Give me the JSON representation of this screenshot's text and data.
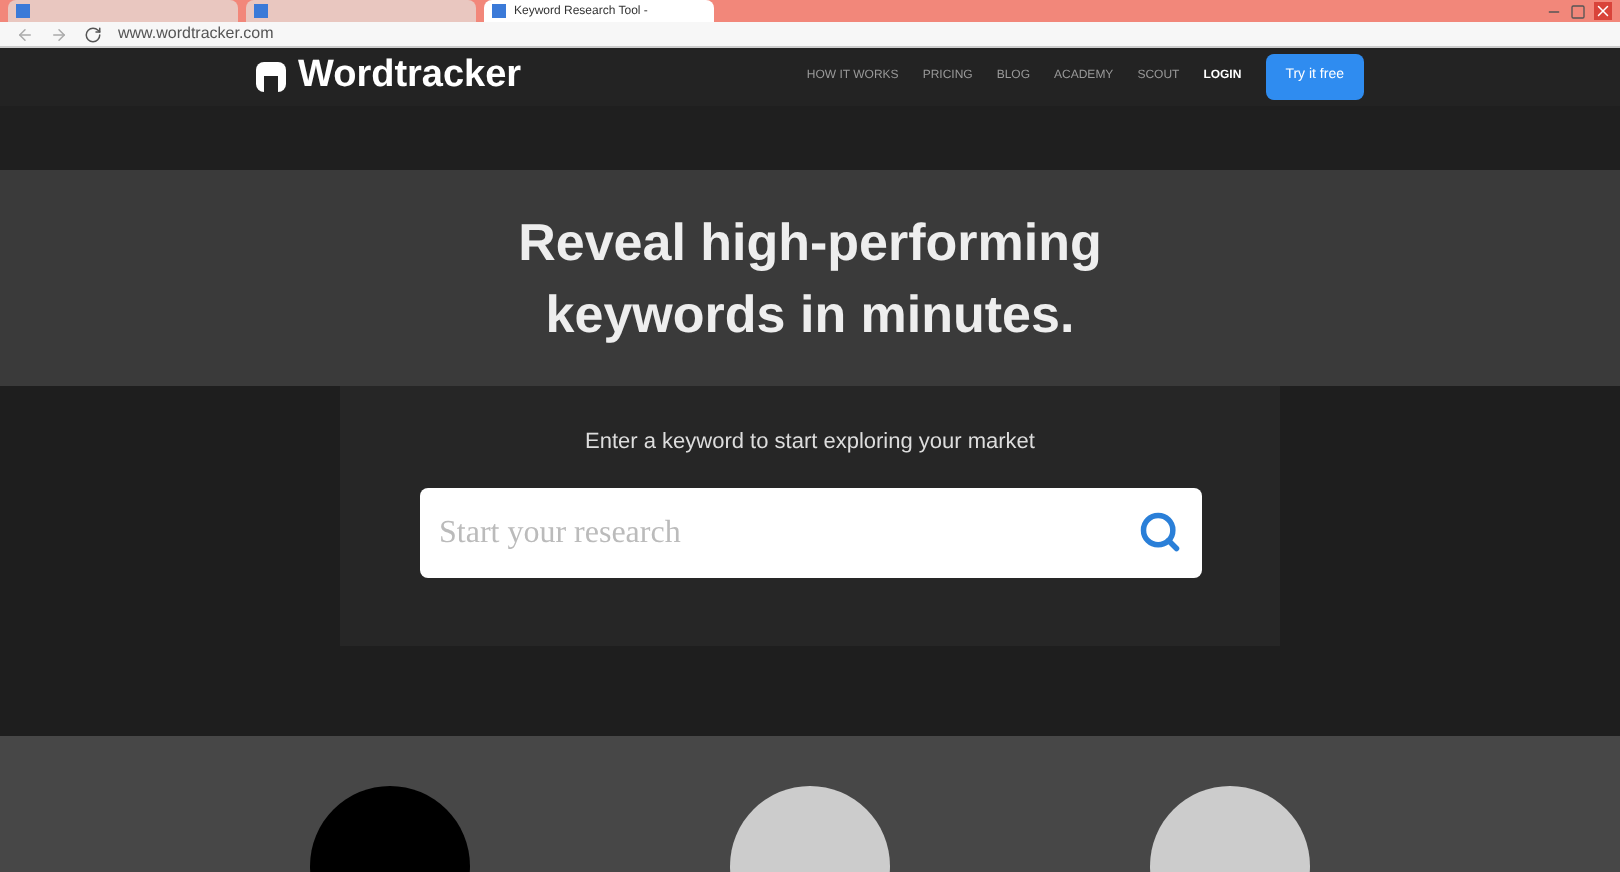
{
  "browser": {
    "tabs": [
      {
        "selected": false
      },
      {
        "selected": false
      },
      {
        "title": "Keyword Research Tool -",
        "selected": true
      }
    ],
    "address": "www.wordtracker.com"
  },
  "nav": {
    "brand": "Wordtracker",
    "links": [
      "HOW IT WORKS",
      "PRICING",
      "BLOG",
      "ACADEMY",
      "SCOUT",
      "LOGIN"
    ],
    "cta": "Try it free"
  },
  "hero": {
    "headline_lines": [
      "Reveal high-performing",
      "keywords in minutes."
    ],
    "subtitle": "Enter a keyword to start exploring your market",
    "search": {
      "placeholder": "Start your research"
    }
  },
  "features": [
    {
      "kind": "dark"
    },
    {
      "kind": "light"
    },
    {
      "kind": "light"
    }
  ]
}
